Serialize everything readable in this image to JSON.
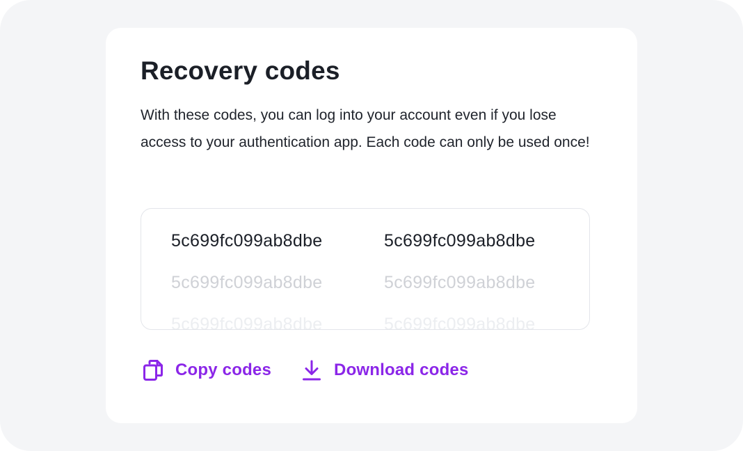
{
  "card": {
    "title": "Recovery codes",
    "description": "With these codes, you can log into your account even if you lose access to your authentication app. Each code can only be used once!"
  },
  "codes": [
    "5c699fc099ab8dbe",
    "5c699fc099ab8dbe",
    "5c699fc099ab8dbe",
    "5c699fc099ab8dbe",
    "5c699fc099ab8dbe",
    "5c699fc099ab8dbe"
  ],
  "actions": {
    "copy": {
      "label": "Copy codes",
      "icon": "copy-icon"
    },
    "download": {
      "label": "Download codes",
      "icon": "download-icon"
    }
  },
  "colors": {
    "accent": "#8b26e8",
    "text": "#1b1f27",
    "background": "#f4f5f7",
    "card": "#ffffff"
  }
}
